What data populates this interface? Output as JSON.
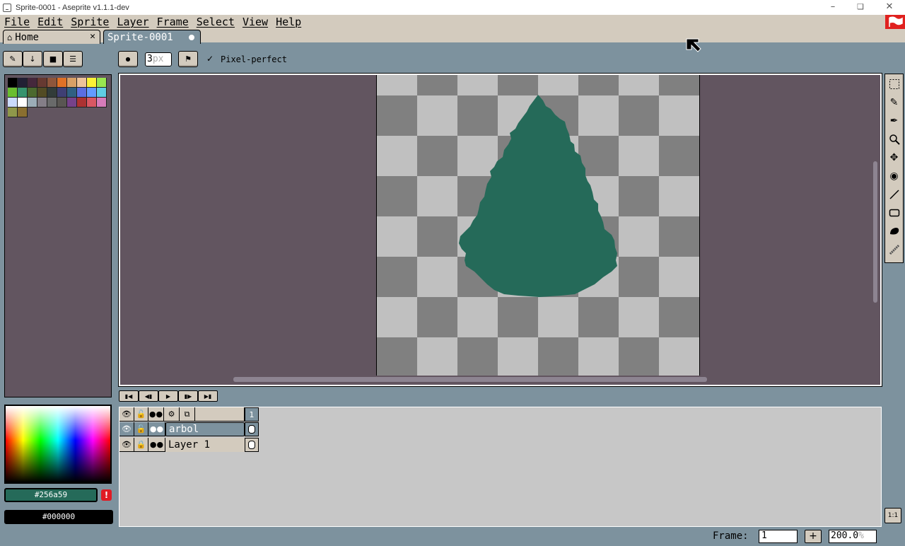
{
  "window": {
    "title": "Sprite-0001 - Aseprite v1.1.1-dev"
  },
  "menu": [
    "File",
    "Edit",
    "Sprite",
    "Layer",
    "Frame",
    "Select",
    "View",
    "Help"
  ],
  "tabs": [
    {
      "label": "Home",
      "icon": "home-icon"
    },
    {
      "label": "Sprite-0001",
      "modified": true
    }
  ],
  "context_bar": {
    "brush_size": "3",
    "brush_unit": "px",
    "pixel_perfect_label": "Pixel-perfect",
    "pixel_perfect_checked": true
  },
  "palette": [
    "#000000",
    "#222034",
    "#45283c",
    "#663931",
    "#8f563b",
    "#df7126",
    "#d9a066",
    "#eec39a",
    "#fbf236",
    "#99e550",
    "#6abe30",
    "#37946e",
    "#4b692f",
    "#524b24",
    "#323c39",
    "#3f3f74",
    "#306082",
    "#5b6ee1",
    "#639bff",
    "#5fcde4",
    "#cbdbfc",
    "#ffffff",
    "#9badb7",
    "#847e87",
    "#696a6a",
    "#595652",
    "#76428a",
    "#ac3232",
    "#d95763",
    "#d77bba",
    "#8f974a",
    "#8a6f30"
  ],
  "colors": {
    "foreground": "#256a59",
    "background": "#000000",
    "foreground_label": "#256a59",
    "background_label": "#000000",
    "canvas_bg": "#625560",
    "tree": "#256a59"
  },
  "timeline": {
    "frame_header": "1",
    "layers": [
      {
        "name": "arbol",
        "selected": true
      },
      {
        "name": "Layer 1",
        "selected": false
      }
    ]
  },
  "zoom_reset_label": "1:1",
  "status": {
    "frame_label": "Frame:",
    "frame_value": "1",
    "add_label": "+",
    "zoom_value": "200.0",
    "zoom_unit": "%"
  }
}
